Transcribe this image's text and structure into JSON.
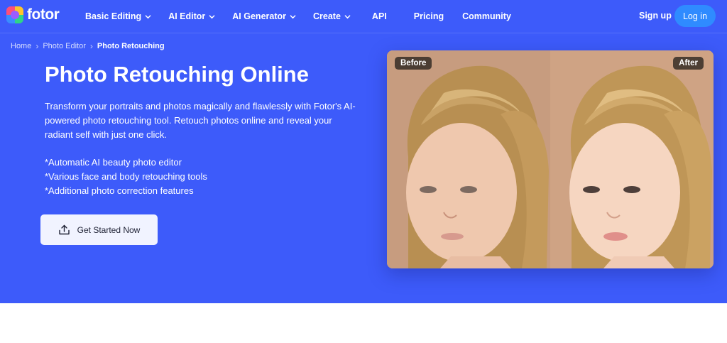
{
  "brand": {
    "name": "fotor"
  },
  "nav": {
    "items": [
      {
        "label": "Basic Editing",
        "dropdown": true
      },
      {
        "label": "AI Editor",
        "dropdown": true
      },
      {
        "label": "AI Generator",
        "dropdown": true
      },
      {
        "label": "Create",
        "dropdown": true
      },
      {
        "label": "API",
        "dropdown": false
      },
      {
        "label": "Pricing",
        "dropdown": false
      },
      {
        "label": "Community",
        "dropdown": false
      }
    ],
    "signup": "Sign up",
    "login": "Log in"
  },
  "breadcrumb": {
    "items": [
      "Home",
      "Photo Editor",
      "Photo Retouching"
    ]
  },
  "hero": {
    "title": "Photo Retouching Online",
    "description": "Transform your portraits and photos magically and flawlessly with Fotor's AI-powered photo retouching tool. Retouch photos online and reveal your radiant self with just one click.",
    "features": [
      "*Automatic AI beauty photo editor",
      "*Various face and body retouching tools",
      "*Additional photo correction features"
    ],
    "cta": "Get Started Now"
  },
  "comparison": {
    "before_label": "Before",
    "after_label": "After"
  },
  "colors": {
    "hero_bg": "#3d5bfa",
    "login_button": "#2f8bff",
    "cta_bg": "#f1f3ff"
  }
}
